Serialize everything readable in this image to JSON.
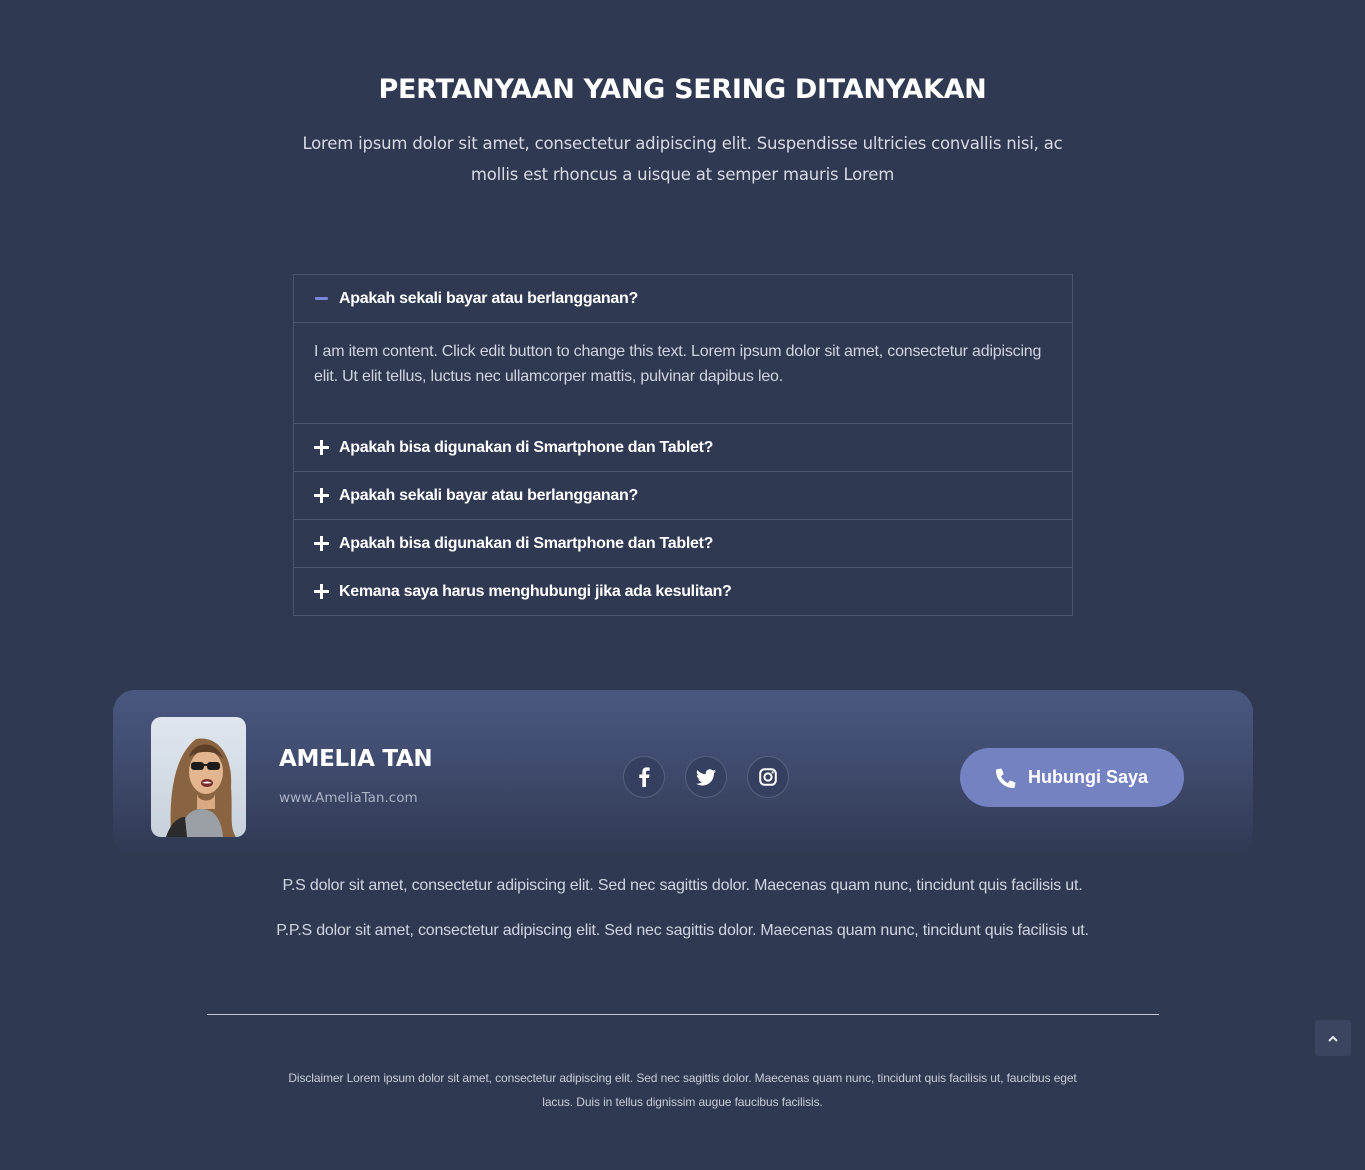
{
  "faq": {
    "title": "PERTANYAAN YANG SERING DITANYAKAN",
    "subtitle": "Lorem ipsum dolor sit amet, consectetur adipiscing elit. Suspendisse ultricies convallis nisi, ac mollis est rhoncus a uisque at semper mauris Lorem",
    "items": [
      {
        "question": "Apakah sekali bayar atau berlangganan?",
        "expanded": true,
        "answer": "I am item content. Click edit button to change this text. Lorem ipsum dolor sit amet, consectetur adipiscing elit. Ut elit tellus, luctus nec ullamcorper mattis, pulvinar dapibus leo."
      },
      {
        "question": "Apakah bisa digunakan di Smartphone dan Tablet?",
        "expanded": false
      },
      {
        "question": "Apakah sekali bayar atau berlangganan?",
        "expanded": false
      },
      {
        "question": "Apakah bisa digunakan di Smartphone dan Tablet?",
        "expanded": false
      },
      {
        "question": "Kemana saya harus menghubungi jika ada kesulitan?",
        "expanded": false
      }
    ]
  },
  "profile": {
    "name": "AMELIA TAN",
    "website": "www.AmeliaTan.com",
    "socials": [
      "facebook-icon",
      "twitter-icon",
      "instagram-icon"
    ],
    "contact_label": "Hubungi Saya",
    "accent_color": "#7582c2"
  },
  "notes": {
    "ps": "P.S  dolor sit amet, consectetur adipiscing elit. Sed nec sagittis dolor. Maecenas quam nunc, tincidunt quis facilisis ut.",
    "pps": "P.P.S  dolor sit amet, consectetur adipiscing elit. Sed nec sagittis dolor. Maecenas quam nunc, tincidunt quis facilisis ut."
  },
  "disclaimer": "Disclaimer Lorem ipsum dolor sit amet, consectetur adipiscing elit. Sed nec sagittis dolor. Maecenas quam nunc, tincidunt quis facilisis ut, faucibus eget lacus. Duis in tellus dignissim augue faucibus facilisis."
}
